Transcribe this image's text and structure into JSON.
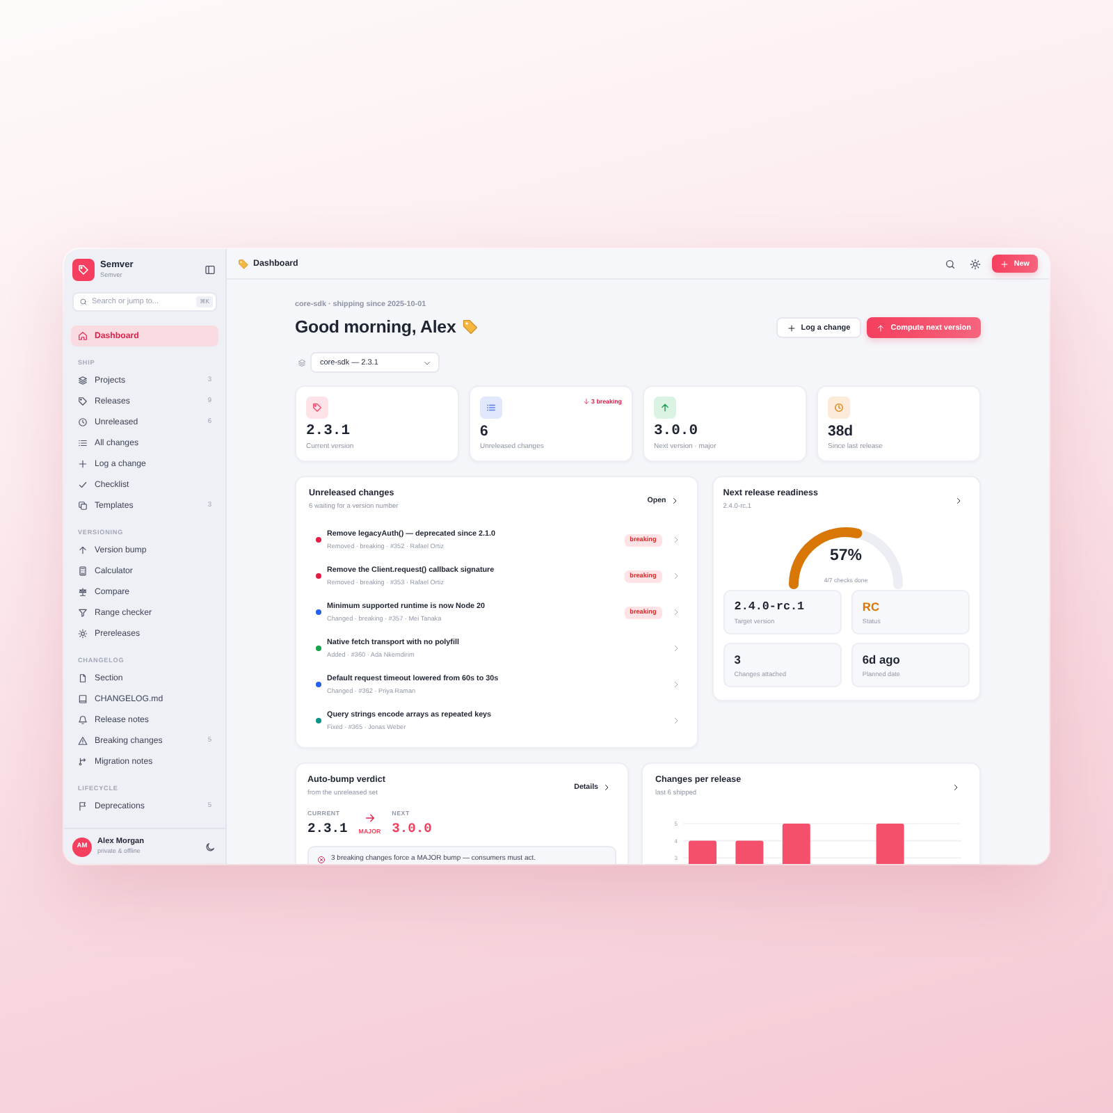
{
  "sidebar": {
    "brand": {
      "name": "Semver",
      "subtitle": "Semver"
    },
    "search": {
      "placeholder": "Search or jump to...",
      "shortcut": "⌘K"
    },
    "items": [
      {
        "label": "Dashboard",
        "selected": true
      }
    ],
    "sections": [
      {
        "title": "SHIP",
        "items": [
          {
            "label": "Projects",
            "count": "3",
            "selected": false
          },
          {
            "label": "Releases",
            "count": "9",
            "selected": false
          },
          {
            "label": "Unreleased",
            "count": "6",
            "selected": false
          },
          {
            "label": "All changes",
            "selected": false
          },
          {
            "label": "Log a change",
            "selected": false
          },
          {
            "label": "Checklist",
            "selected": false
          },
          {
            "label": "Templates",
            "count": "3",
            "selected": false
          }
        ]
      },
      {
        "title": "VERSIONING",
        "items": [
          {
            "label": "Version bump",
            "selected": false
          },
          {
            "label": "Calculator",
            "selected": false
          },
          {
            "label": "Compare",
            "selected": false
          },
          {
            "label": "Range checker",
            "selected": false
          },
          {
            "label": "Prereleases",
            "selected": false
          }
        ]
      },
      {
        "title": "CHANGELOG",
        "items": [
          {
            "label": "Section",
            "selected": false
          },
          {
            "label": "CHANGELOG.md",
            "selected": false
          },
          {
            "label": "Release notes",
            "selected": false
          },
          {
            "label": "Breaking changes",
            "count": "5",
            "selected": false
          },
          {
            "label": "Migration notes",
            "selected": false
          }
        ]
      },
      {
        "title": "LIFECYCLE",
        "items": [
          {
            "label": "Deprecations",
            "count": "5",
            "selected": false
          }
        ]
      }
    ],
    "user": {
      "initials": "AM",
      "name": "Alex Morgan",
      "status": "private & offline"
    }
  },
  "topbar": {
    "title": "Dashboard",
    "new_button": "New"
  },
  "header": {
    "eyebrow": "core-sdk · shipping since 2025-10-01",
    "greeting": "Good morning, Alex",
    "actions": [
      {
        "label": "Log a change",
        "kind": "secondary"
      },
      {
        "label": "Compute next version",
        "kind": "primary"
      }
    ],
    "project_select": {
      "value": "core-sdk — 2.3.1"
    }
  },
  "stats": [
    {
      "kind": "version",
      "value": "2.3.1",
      "label": "Current version"
    },
    {
      "kind": "number",
      "value": "6",
      "label": "Unreleased changes",
      "delta": "3 breaking"
    },
    {
      "kind": "version",
      "value": "3.0.0",
      "label": "Next version · major"
    },
    {
      "kind": "number",
      "value": "38d",
      "label": "Since last release"
    }
  ],
  "unreleased": {
    "title": "Unreleased changes",
    "subtitle": "6 waiting for a version number",
    "action": "Open",
    "rows": [
      {
        "title": "Remove legacyAuth() — deprecated since 2.1.0",
        "meta": "Removed · breaking · #352 · Rafael Ortiz",
        "color": "#e11d48",
        "badge": "breaking"
      },
      {
        "title": "Remove the Client.request() callback signature",
        "meta": "Removed · breaking · #353 · Rafael Ortiz",
        "color": "#e11d48",
        "badge": "breaking"
      },
      {
        "title": "Minimum supported runtime is now Node 20",
        "meta": "Changed · breaking · #357 · Mei Tanaka",
        "color": "#2563eb",
        "badge": "breaking"
      },
      {
        "title": "Native fetch transport with no polyfill",
        "meta": "Added · #360 · Ada Nkemdirim",
        "color": "#16a34a"
      },
      {
        "title": "Default request timeout lowered from 60s to 30s",
        "meta": "Changed · #362 · Priya Raman",
        "color": "#2563eb"
      },
      {
        "title": "Query strings encode arrays as repeated keys",
        "meta": "Fixed · #365 · Jonas Weber",
        "color": "#0d9488"
      }
    ]
  },
  "readiness": {
    "title": "Next release readiness",
    "subtitle": "2.4.0-rc.1",
    "gauge": {
      "level": 0.57,
      "value": "57%",
      "caption": "4/7 checks done"
    },
    "facts": [
      {
        "kind": "version",
        "value": "2.4.0-rc.1",
        "label": "Target version"
      },
      {
        "kind": "status",
        "value": "RC",
        "label": "Status"
      },
      {
        "kind": "number",
        "value": "3",
        "label": "Changes attached"
      },
      {
        "kind": "number",
        "value": "6d ago",
        "label": "Planned date"
      }
    ]
  },
  "verdict": {
    "title": "Auto-bump verdict",
    "subtitle": "from the unreleased set",
    "action": "Details",
    "current": {
      "label": "CURRENT",
      "value": "2.3.1"
    },
    "bump": "MAJOR",
    "next": {
      "label": "NEXT",
      "value": "3.0.0"
    },
    "alert": "3 breaking changes force a MAJOR bump — consumers must act."
  },
  "changes_chart": {
    "title": "Changes per release",
    "subtitle": "last 6 shipped",
    "chart_data": {
      "type": "bar",
      "values": [
        4,
        4,
        5,
        null,
        5,
        null
      ],
      "ylim": [
        0,
        5
      ],
      "yticks": [
        3,
        4,
        5
      ]
    }
  }
}
